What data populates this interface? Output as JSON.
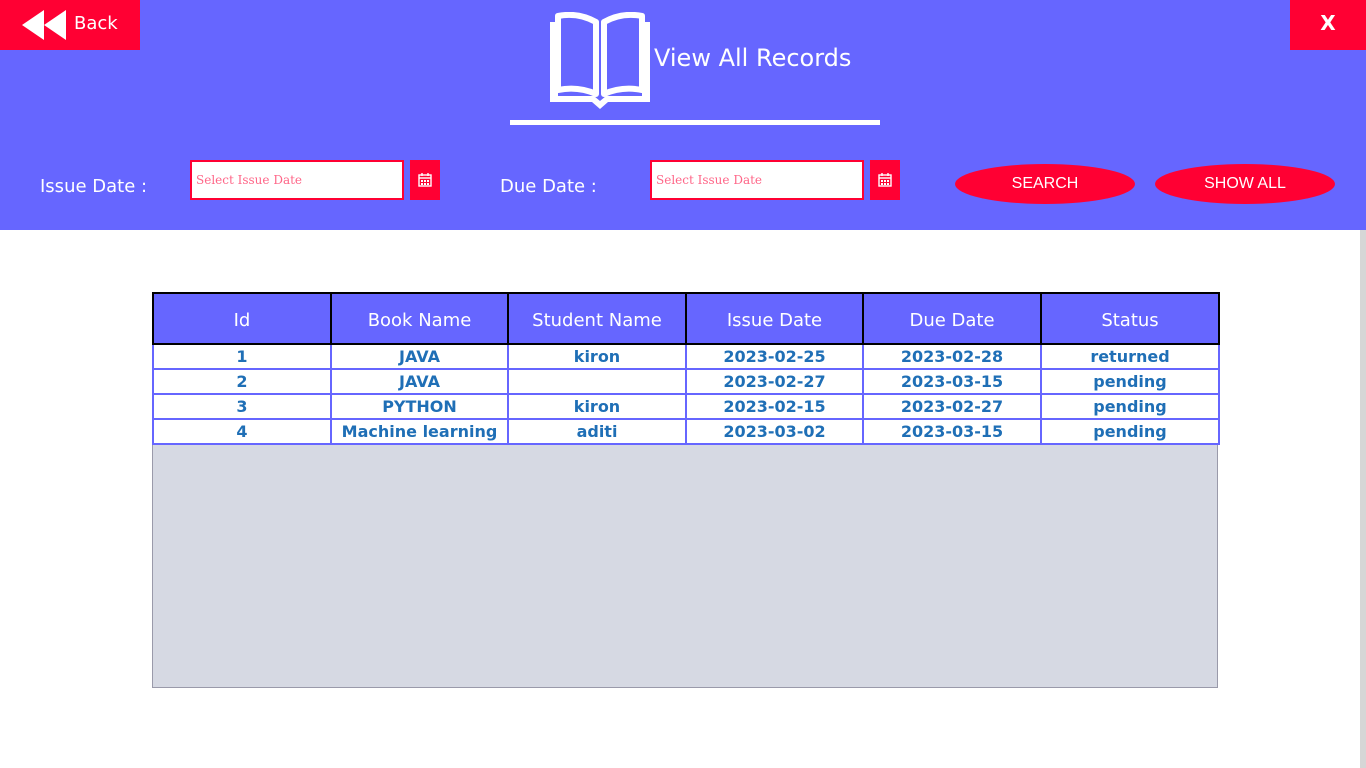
{
  "header": {
    "back_label": "Back",
    "close_label": "X",
    "title": "View All Records",
    "accent_color": "#6666ff",
    "button_color": "#ff0033"
  },
  "filters": {
    "issue_label": "Issue Date :",
    "issue_placeholder": "Select Issue Date",
    "due_label": "Due Date :",
    "due_placeholder": "Select Issue Date",
    "calendar_icon": "calendar-icon",
    "search_label": "SEARCH",
    "show_all_label": "SHOW ALL"
  },
  "table": {
    "headers": [
      "Id",
      "Book Name",
      "Student Name",
      "Issue Date",
      "Due Date",
      "Status"
    ],
    "rows": [
      [
        "1",
        "JAVA",
        "kiron",
        "2023-02-25",
        "2023-02-28",
        "returned"
      ],
      [
        "2",
        "JAVA",
        "",
        "2023-02-27",
        "2023-03-15",
        "pending"
      ],
      [
        "3",
        "PYTHON",
        "kiron",
        "2023-02-15",
        "2023-02-27",
        "pending"
      ],
      [
        "4",
        "Machine learning",
        "aditi",
        "2023-03-02",
        "2023-03-15",
        "pending"
      ]
    ]
  }
}
